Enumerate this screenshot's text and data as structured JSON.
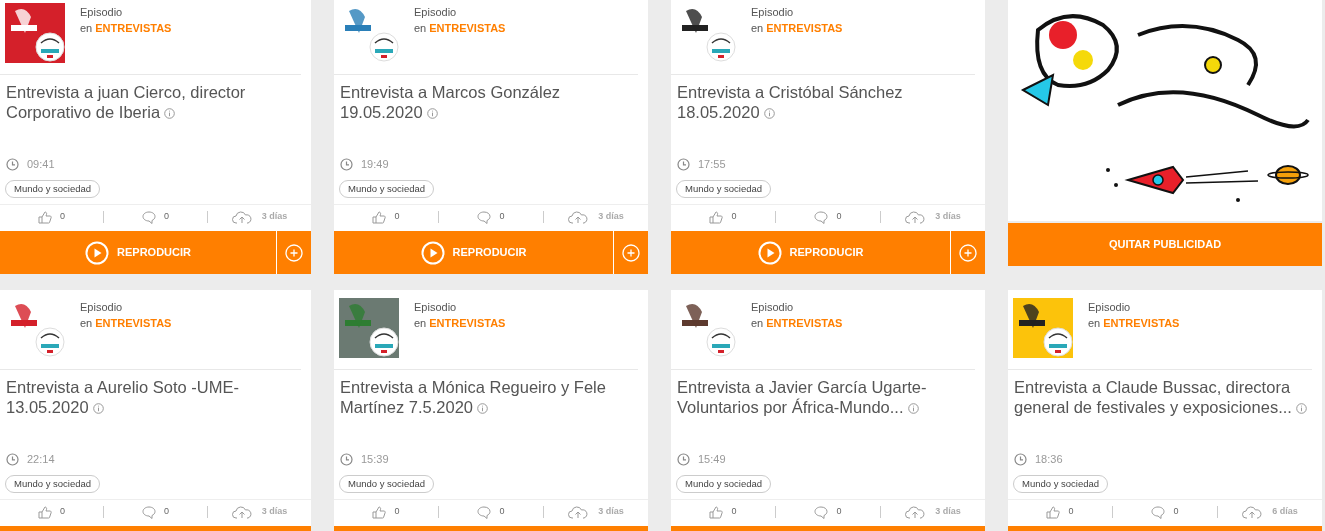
{
  "cards": [
    {
      "kind": "episode",
      "type_label": "Episodio",
      "category_prefix": "en",
      "category": "ENTREVISTAS",
      "title": "Entrevista a juan Cierco, director Corporativo de Iberia",
      "duration": "09:41",
      "tag": "Mundo y sociedad",
      "likes": "0",
      "comments": "0",
      "uploaded": "3 días",
      "play_label": "REPRODUCIR"
    },
    {
      "kind": "episode",
      "type_label": "Episodio",
      "category_prefix": "en",
      "category": "ENTREVISTAS",
      "title": "Entrevista a Marcos González 19.05.2020",
      "duration": "19:49",
      "tag": "Mundo y sociedad",
      "likes": "0",
      "comments": "0",
      "uploaded": "3 días",
      "play_label": "REPRODUCIR"
    },
    {
      "kind": "episode",
      "type_label": "Episodio",
      "category_prefix": "en",
      "category": "ENTREVISTAS",
      "title": "Entrevista a Cristóbal Sánchez 18.05.2020",
      "duration": "17:55",
      "tag": "Mundo y sociedad",
      "likes": "0",
      "comments": "0",
      "uploaded": "3 días",
      "play_label": "REPRODUCIR"
    },
    {
      "kind": "ad",
      "button_label": "QUITAR PUBLICIDAD"
    },
    {
      "kind": "episode",
      "type_label": "Episodio",
      "category_prefix": "en",
      "category": "ENTREVISTAS",
      "title": "Entrevista a Aurelio Soto -UME- 13.05.2020",
      "duration": "22:14",
      "tag": "Mundo y sociedad",
      "likes": "0",
      "comments": "0",
      "uploaded": "3 días"
    },
    {
      "kind": "episode",
      "type_label": "Episodio",
      "category_prefix": "en",
      "category": "ENTREVISTAS",
      "title": "Entrevista a Mónica Regueiro y Fele Martínez 7.5.2020",
      "duration": "15:39",
      "tag": "Mundo y sociedad",
      "likes": "0",
      "comments": "0",
      "uploaded": "3 días"
    },
    {
      "kind": "episode",
      "type_label": "Episodio",
      "category_prefix": "en",
      "category": "ENTREVISTAS",
      "title": "Entrevista a Javier García Ugarte-Voluntarios por África-Mundo...",
      "duration": "15:49",
      "tag": "Mundo y sociedad",
      "likes": "0",
      "comments": "0",
      "uploaded": "3 días"
    },
    {
      "kind": "episode",
      "type_label": "Episodio",
      "category_prefix": "en",
      "category": "ENTREVISTAS",
      "title": "Entrevista a Claude Bussac, directora general de festivales y exposiciones...",
      "duration": "18:36",
      "tag": "Mundo y sociedad",
      "likes": "0",
      "comments": "0",
      "uploaded": "6 días"
    }
  ]
}
